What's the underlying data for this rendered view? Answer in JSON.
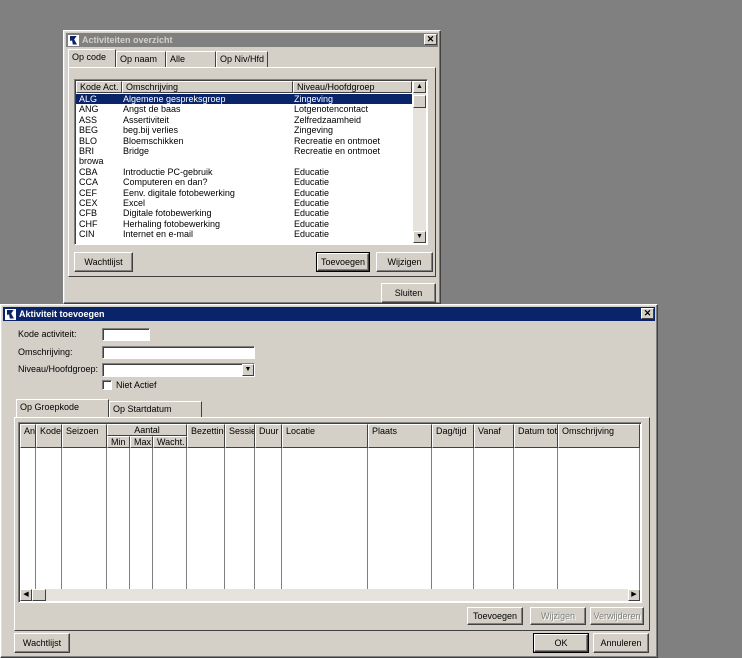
{
  "overview_window": {
    "title": "Activiteiten overzicht",
    "tabs": [
      "Op code",
      "Op naam",
      "Alle",
      "Op Niv/Hfd"
    ],
    "columns": [
      "Kode Act.",
      "Omschrijving",
      "Niveau/Hoofdgroep"
    ],
    "rows": [
      {
        "code": "ALG",
        "desc": "Algemene gespreksgroep",
        "level": "Zingeving",
        "selected": true
      },
      {
        "code": "ANG",
        "desc": "Angst de baas",
        "level": "Lotgenotencontact"
      },
      {
        "code": "ASS",
        "desc": "Assertiviteit",
        "level": "Zelfredzaamheid"
      },
      {
        "code": "BEG",
        "desc": "beg.bij verlies",
        "level": "Zingeving"
      },
      {
        "code": "BLO",
        "desc": "Bloemschikken",
        "level": "Recreatie en ontmoet"
      },
      {
        "code": "BRI",
        "desc": "Bridge",
        "level": "Recreatie en ontmoet"
      },
      {
        "code": "browa",
        "desc": "",
        "level": ""
      },
      {
        "code": "CBA",
        "desc": "Introductie PC-gebruik",
        "level": "Educatie"
      },
      {
        "code": "CCA",
        "desc": "Computeren en dan?",
        "level": "Educatie"
      },
      {
        "code": "CEF",
        "desc": "Eenv. digitale fotobewerking",
        "level": "Educatie"
      },
      {
        "code": "CEX",
        "desc": "Excel",
        "level": "Educatie"
      },
      {
        "code": "CFB",
        "desc": "Digitale fotobewerking",
        "level": "Educatie"
      },
      {
        "code": "CHF",
        "desc": "Herhaling fotobewerking",
        "level": "Educatie"
      },
      {
        "code": "CIN",
        "desc": "Internet en e-mail",
        "level": "Educatie"
      }
    ],
    "buttons": {
      "waitlist": "Wachtlijst",
      "add": "Toevoegen",
      "edit": "Wijzigen",
      "close": "Sluiten"
    }
  },
  "add_window": {
    "title": "Aktiviteit toevoegen",
    "labels": {
      "code": "Kode activiteit:",
      "desc": "Omschrijving:",
      "level": "Niveau/Hoofdgroep:",
      "inactive": "Niet Actief"
    },
    "values": {
      "code": "",
      "desc": "",
      "level": ""
    },
    "tabs": [
      "Op Groepkode",
      "Op Startdatum"
    ],
    "columns": [
      "An",
      "Kode",
      "Seizoen",
      "Aantal",
      "Bezetting",
      "Sessie",
      "Duur",
      "Locatie",
      "Plaats",
      "Dag/tijd",
      "Vanaf",
      "Datum tot",
      "Omschrijving"
    ],
    "subcolumns": [
      "Min",
      "Max",
      "Wacht."
    ],
    "grid_buttons": {
      "add": "Toevoegen",
      "edit": "Wijzigen",
      "delete": "Verwijderen"
    },
    "buttons": {
      "waitlist": "Wachtlijst",
      "ok": "OK",
      "cancel": "Annuleren"
    }
  }
}
